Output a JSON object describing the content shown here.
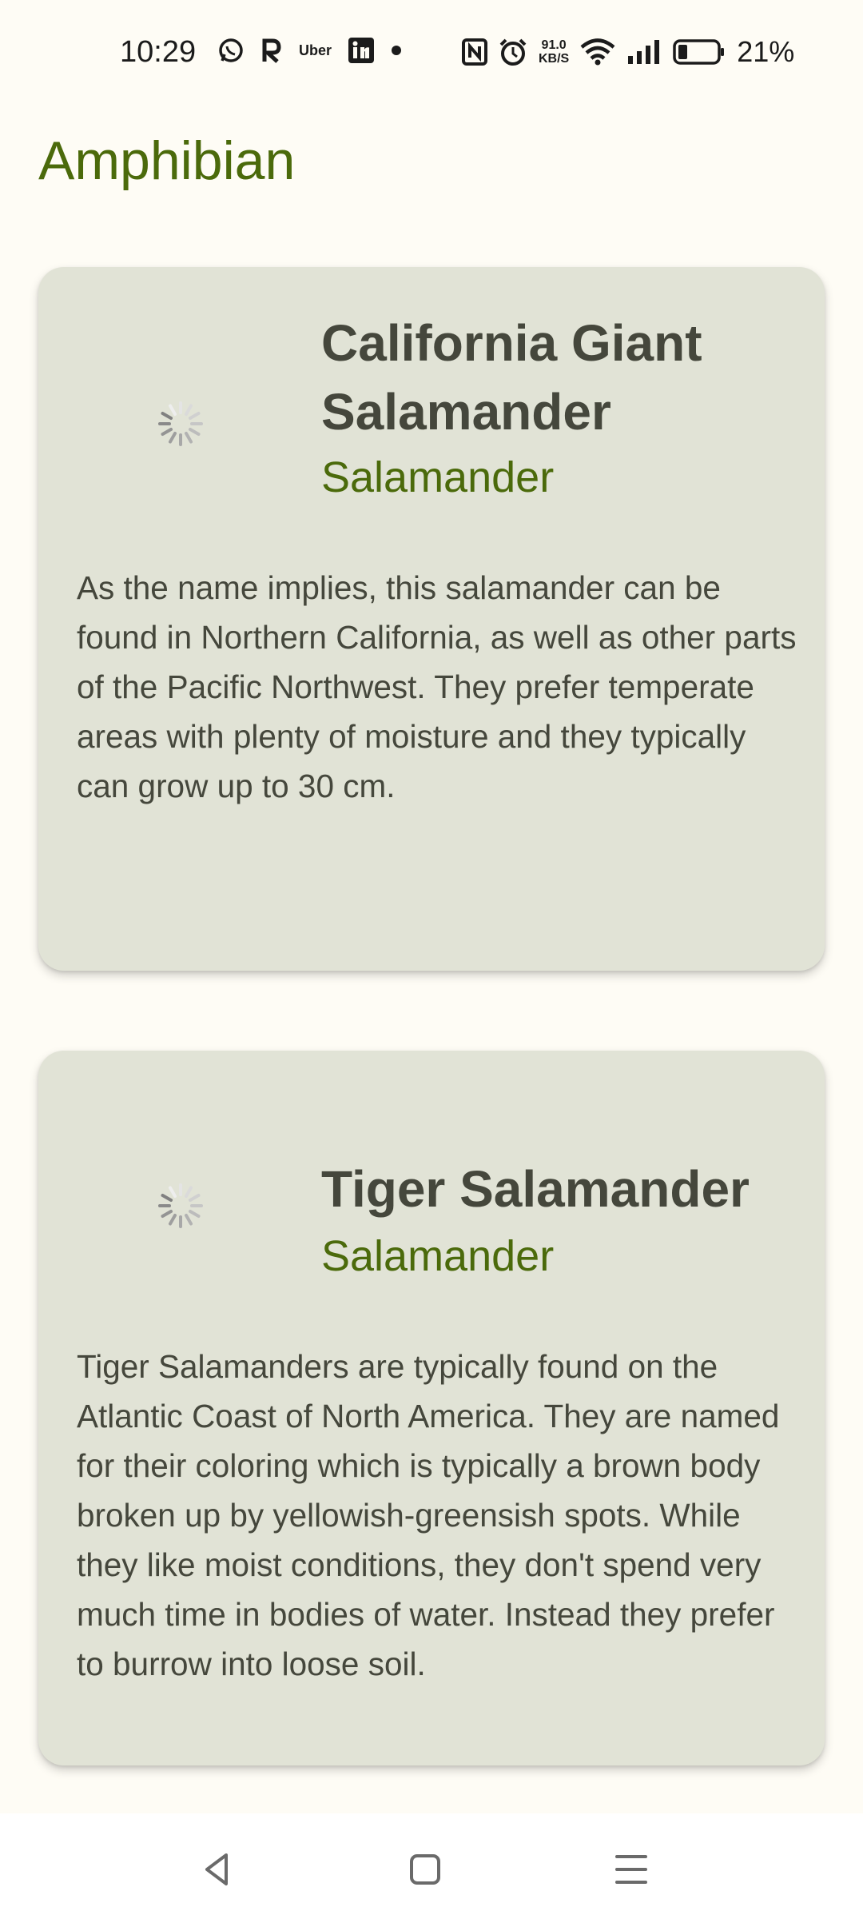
{
  "status_bar": {
    "time": "10:29",
    "app_icons": [
      "whatsapp-icon",
      "r-app-icon",
      "uber-icon",
      "linkedin-icon",
      "dot-icon"
    ],
    "uber_label": "Uber",
    "net_speed_value": "91.0",
    "net_speed_unit": "KB/S",
    "battery_percent": "21%"
  },
  "header": {
    "title": "Amphibian"
  },
  "cards": [
    {
      "name": "California Giant Salamander",
      "type": "Salamander",
      "description": "As the name implies, this salamander can be found in Northern California, as well as other parts of the Pacific Northwest. They prefer temperate areas with plenty of moisture and they typically can grow up to 30 cm."
    },
    {
      "name": "Tiger Salamander",
      "type": "Salamander",
      "description": "Tiger Salamanders are typically found on the Atlantic Coast of North America. They are named for their coloring which is typically a brown body broken up by yellowish-greensish spots. While they like moist conditions, they don't spend very much time in bodies of water. Instead they prefer to burrow into loose soil."
    }
  ],
  "colors": {
    "background": "#fefcf5",
    "accent": "#4b6a0b",
    "card": "#e1e3d6",
    "text": "#45473c"
  },
  "nav_bar": {
    "buttons": [
      "back-icon",
      "home-icon",
      "recents-icon"
    ]
  }
}
